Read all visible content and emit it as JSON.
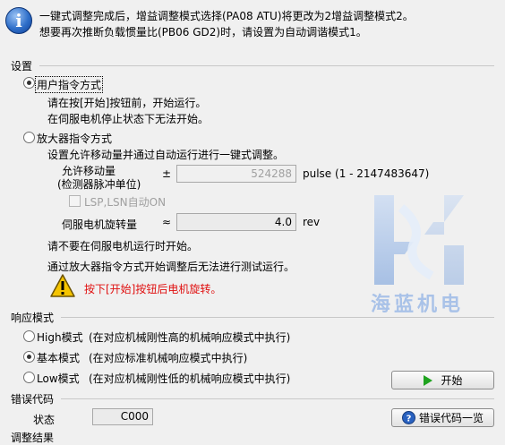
{
  "info": {
    "line1": "一键式调整完成后，增益调整模式选择(PA08 ATU)将更改为2增益调整模式2。",
    "line2": "想要再次推断负载惯量比(PB06 GD2)时，请设置为自动调谐模式1。"
  },
  "settings": {
    "title": "设置",
    "user_cmd": {
      "label": "用户指令方式",
      "selected": true,
      "desc1": "请在按[开始]按钮前，开始运行。",
      "desc2": "在伺服电机停止状态下无法开始。"
    },
    "amp_cmd": {
      "label": "放大器指令方式",
      "selected": false,
      "desc": "设置允许移动量并通过自动运行进行一键式调整。",
      "move_label1": "允许移动量",
      "move_label2": "(检测器脉冲单位)",
      "plusminus": "±",
      "move_value": "524288",
      "move_unit": "pulse (1 - 2147483647)",
      "lsp_label": "LSP,LSN自动ON",
      "rot_label": "伺服电机旋转量",
      "approx": "≈",
      "rot_value": "4.0",
      "rot_unit": "rev",
      "note1": "请不要在伺服电机运行时开始。",
      "note2": "通过放大器指令方式开始调整后无法进行测试运行。",
      "warning": "按下[开始]按钮后电机旋转。"
    }
  },
  "watermark": {
    "text": "海蓝机电",
    "colors": {
      "primary": "#a9c2e8",
      "light": "#d6e3f5"
    }
  },
  "response": {
    "title": "响应模式",
    "options": [
      {
        "label": "High模式",
        "desc": "(在对应机械刚性高的机械响应模式中执行)",
        "selected": false
      },
      {
        "label": "基本模式",
        "desc": "(在对应标准机械响应模式中执行)",
        "selected": true
      },
      {
        "label": "Low模式",
        "desc": "(在对应机械刚性低的机械响应模式中执行)",
        "selected": false
      }
    ]
  },
  "start_button": {
    "label": "开始",
    "icon": "play-icon",
    "icon_color": "#1fa31f"
  },
  "error": {
    "title": "错误代码",
    "status_label": "状态",
    "status_value": "C000",
    "list_button": "错误代码一览",
    "list_icon": "help-icon"
  },
  "footer_partial": "调整结果"
}
